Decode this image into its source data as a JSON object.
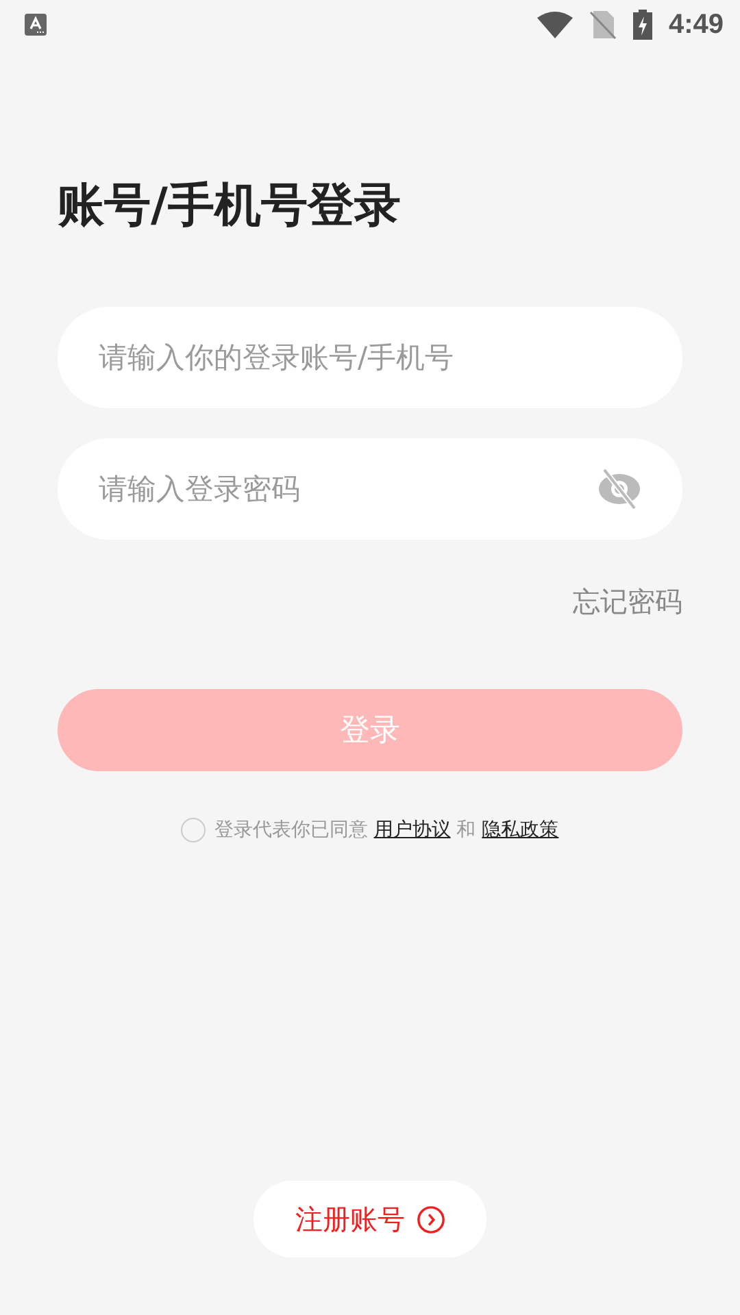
{
  "status_bar": {
    "time": "4:49"
  },
  "title": "账号/手机号登录",
  "account_field": {
    "placeholder": "请输入你的登录账号/手机号"
  },
  "password_field": {
    "placeholder": "请输入登录密码"
  },
  "forgot_link": "忘记密码",
  "login_button": {
    "label": "登录",
    "disabled": true
  },
  "agreement": {
    "checked": false,
    "text": "登录代表你已同意",
    "link_1": "用户协议",
    "joiner": "和",
    "link_2": "隐私政策"
  },
  "register_button": "注册账号"
}
